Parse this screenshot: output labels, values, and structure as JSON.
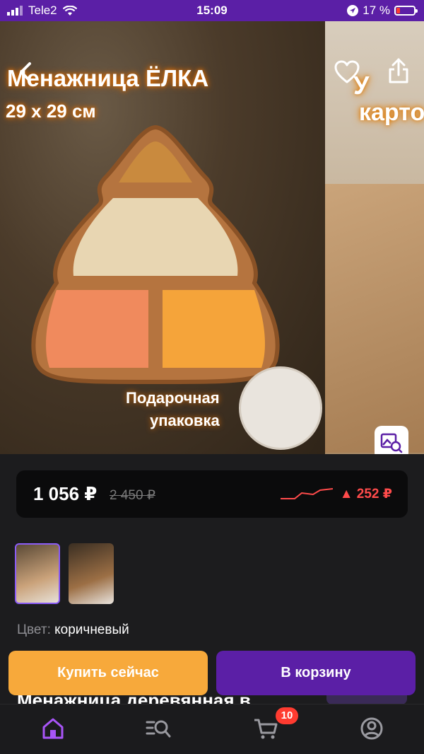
{
  "status_bar": {
    "carrier": "Tele2",
    "time": "15:09",
    "battery": "17 %"
  },
  "gallery": {
    "slide1": {
      "title": "Менажница ЁЛКА",
      "size": "29 x 29 см",
      "gift_line1": "Подарочная",
      "gift_line2": "упаковка"
    },
    "slide2": {
      "title_line1": "У",
      "title_line2": "карто"
    }
  },
  "price": {
    "current": "1 056 ₽",
    "old": "2 450 ₽",
    "delta": "▲ 252 ₽",
    "trend_color": "#ff4b4b"
  },
  "attributes": {
    "color_label": "Цвет:",
    "color_value": "коричневый"
  },
  "product": {
    "title_partial": "Менажница деревянная в"
  },
  "actions": {
    "buy_now": "Купить сейчас",
    "to_cart": "В корзину"
  },
  "tabbar": {
    "cart_badge": "10"
  },
  "colors": {
    "accent": "#5b1fa6",
    "buy_now": "#f7a93b",
    "delta": "#ff4b4b"
  }
}
